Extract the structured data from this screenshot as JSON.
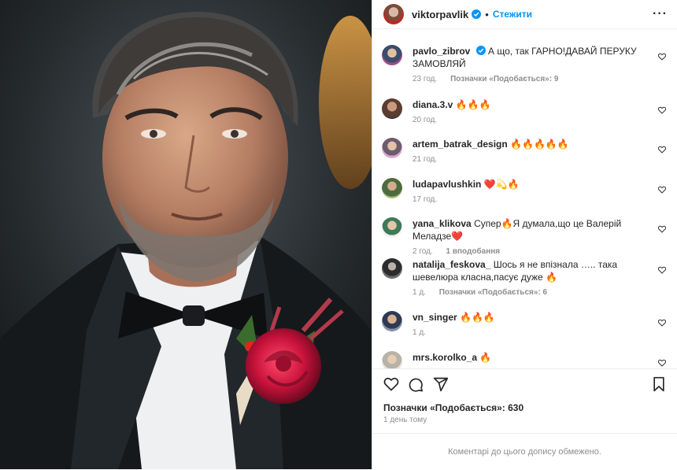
{
  "header": {
    "username": "viktorpavlik",
    "separator": "•",
    "follow_label": "Стежити",
    "more_label": "···"
  },
  "comments": [
    {
      "user": "pavlo_zibrov",
      "verified": true,
      "text": "А що, так ГАРНО!ДАВАЙ ПЕРУКУ ЗАМОВЛЯЙ",
      "time": "23 год.",
      "likes": "Позначки «Подобається»: 9"
    },
    {
      "user": "diana.3.v",
      "text": "🔥🔥🔥",
      "time": "20 год.",
      "likes": ""
    },
    {
      "user": "artem_batrak_design",
      "text": "🔥🔥🔥🔥🔥",
      "time": "21 год.",
      "likes": ""
    },
    {
      "user": "ludapavlushkin",
      "text": "❤️💫🔥",
      "time": "17 год.",
      "likes": ""
    },
    {
      "user": "yana_klikova",
      "text": "Супер🔥Я думала,що це Валерій Меладзе❤️",
      "time": "2 год.",
      "likes": "1 вподобання"
    },
    {
      "user": "natalija_feskova_",
      "text": "Шось я не впізнала ….. така шевелюра класна,пасує дуже 🔥",
      "time": "1 д.",
      "likes": "Позначки «Подобається»: 6"
    },
    {
      "user": "vn_singer",
      "text": "🔥🔥🔥",
      "time": "1 д.",
      "likes": ""
    },
    {
      "user": "mrs.korolko_a",
      "text": "🔥",
      "time": "",
      "likes": ""
    }
  ],
  "footer": {
    "likes_total": "Позначки «Подобається»: 630",
    "date": "1 день тому",
    "comments_closed": "Коментарі до цього допису обмежено."
  },
  "colors": {
    "accent": "#0095f6",
    "text": "#262626",
    "muted": "#8e8e8e",
    "verified": "#0095f6",
    "fire": "#e8582a",
    "red_heart": "#e0245e"
  },
  "icons": [
    "verified-badge-icon",
    "heart-icon",
    "comment-icon",
    "share-icon",
    "bookmark-icon",
    "more-icon"
  ]
}
